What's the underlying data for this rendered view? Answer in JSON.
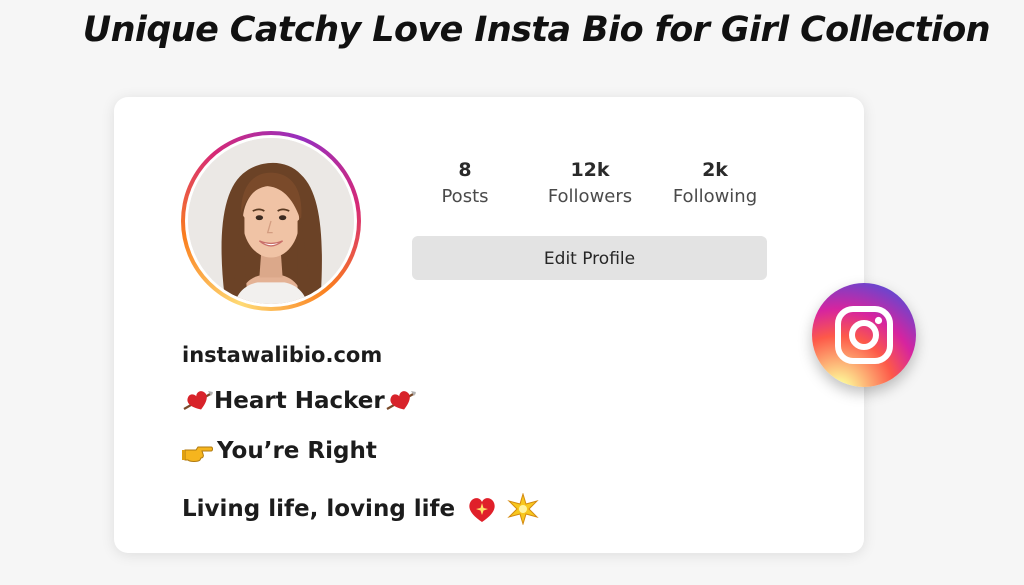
{
  "headline": "Unique Catchy Love Insta Bio for Girl Collection",
  "profile": {
    "stats": [
      {
        "value": "8",
        "label": "Posts"
      },
      {
        "value": "12k",
        "label": "Followers"
      },
      {
        "value": "2k",
        "label": "Following"
      }
    ],
    "edit_button_label": "Edit Profile",
    "avatar_icon": "profile-photo"
  },
  "bio": {
    "website": "instawalibio.com",
    "line1": {
      "text": "Heart Hacker",
      "icon_before": "heart-with-arrow-icon",
      "icon_after": "heart-with-arrow-icon"
    },
    "line2": {
      "text": "You’re Right",
      "icon_before": "pointing-right-hand-icon"
    },
    "line3": {
      "text": "Living life, loving life",
      "icons_after": [
        "sparkling-heart-icon",
        "sparkle-star-icon"
      ]
    }
  },
  "badge": {
    "icon": "instagram-icon"
  },
  "colors": {
    "ring_gradient": [
      "#feda75",
      "#fa7e1e",
      "#d62976",
      "#962fbf"
    ],
    "button_bg": "#e3e3e3",
    "card_bg": "#ffffff",
    "page_bg": "#f6f6f6"
  }
}
